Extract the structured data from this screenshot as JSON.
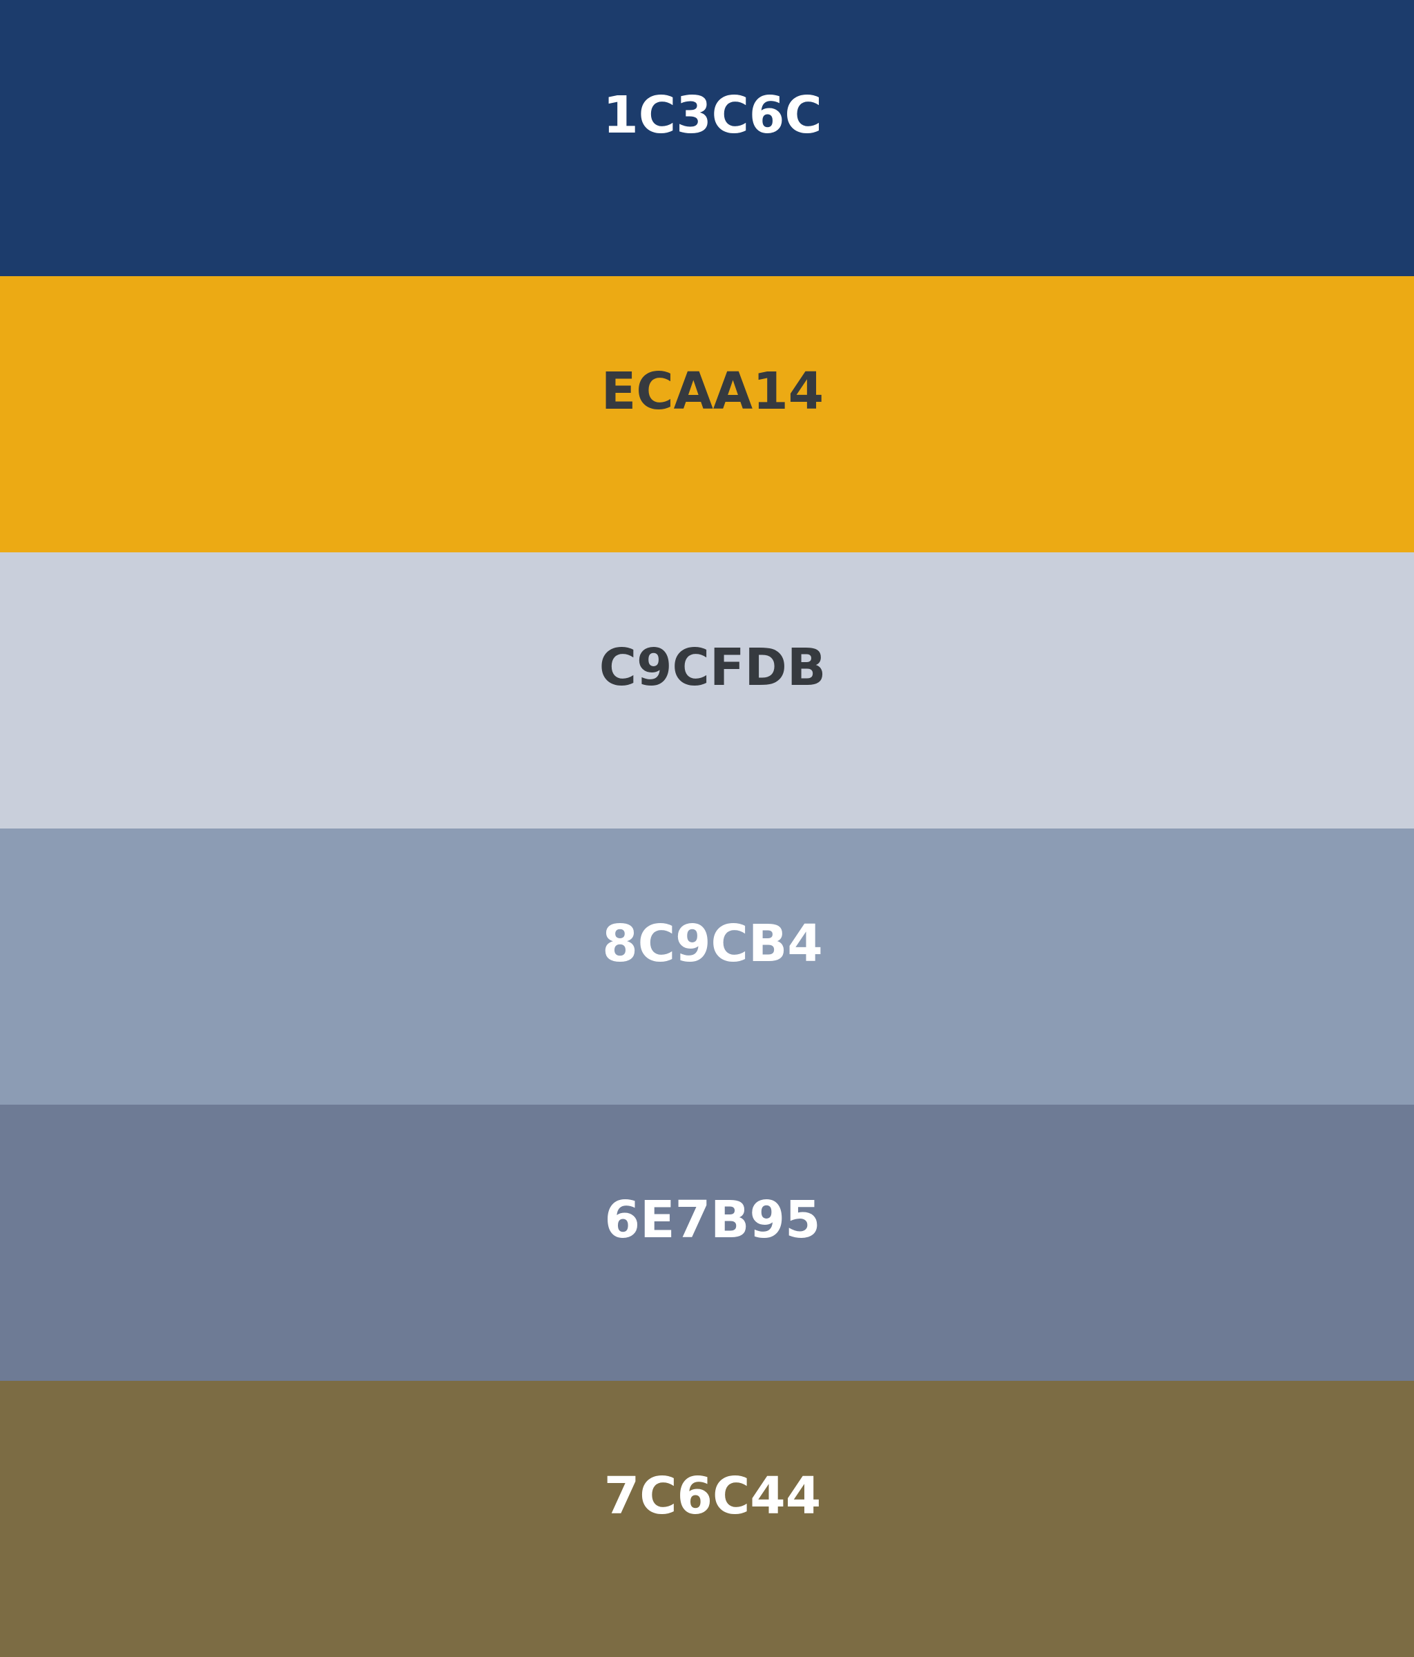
{
  "swatches": [
    {
      "hex": "1C3C6C",
      "color": "#1C3C6C",
      "text_color": "#FFFFFF"
    },
    {
      "hex": "ECAA14",
      "color": "#ECAA14",
      "text_color": "#363A3F"
    },
    {
      "hex": "C9CFDB",
      "color": "#C9CFDB",
      "text_color": "#363A3F"
    },
    {
      "hex": "8C9CB4",
      "color": "#8C9CB4",
      "text_color": "#FFFFFF"
    },
    {
      "hex": "6E7B95",
      "color": "#6E7B95",
      "text_color": "#FFFFFF"
    },
    {
      "hex": "7C6C44",
      "color": "#7C6C44",
      "text_color": "#FFFFFF"
    }
  ]
}
